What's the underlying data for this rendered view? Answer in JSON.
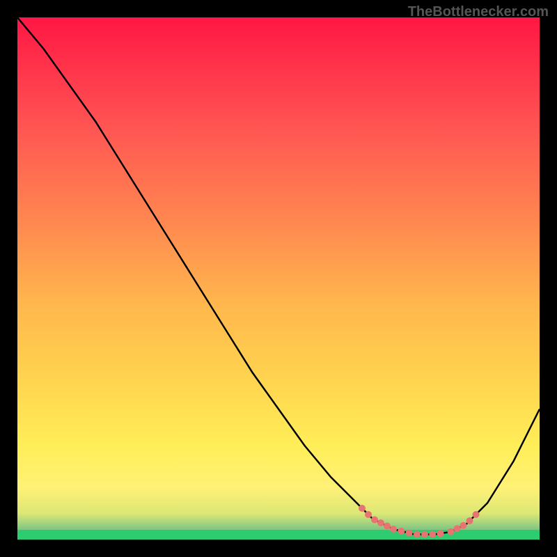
{
  "watermark": "TheBottlenecker.com",
  "chart_data": {
    "type": "line",
    "title": "",
    "xlabel": "",
    "ylabel": "",
    "xlim": [
      0,
      100
    ],
    "ylim": [
      0,
      100
    ],
    "grid": false,
    "series": [
      {
        "name": "curve",
        "x": [
          0,
          5,
          10,
          15,
          20,
          25,
          30,
          35,
          40,
          45,
          50,
          55,
          60,
          65,
          68,
          72,
          76,
          80,
          83,
          86,
          90,
          95,
          100
        ],
        "y": [
          100,
          94,
          87,
          80,
          72,
          64,
          56,
          48,
          40,
          32,
          25,
          18,
          12,
          7,
          4,
          2,
          1,
          1,
          1.5,
          3,
          7,
          15,
          25
        ]
      }
    ],
    "optimal_zone": {
      "x_start": 66,
      "x_end": 88
    },
    "gradient_stops": [
      {
        "offset": 0,
        "color": "#ff1744"
      },
      {
        "offset": 20,
        "color": "#ff5252"
      },
      {
        "offset": 40,
        "color": "#ff8a50"
      },
      {
        "offset": 55,
        "color": "#ffb74d"
      },
      {
        "offset": 70,
        "color": "#ffd54f"
      },
      {
        "offset": 82,
        "color": "#ffee58"
      },
      {
        "offset": 90,
        "color": "#fff176"
      },
      {
        "offset": 95,
        "color": "#dce775"
      },
      {
        "offset": 98,
        "color": "#81c784"
      },
      {
        "offset": 100,
        "color": "#4caf50"
      }
    ]
  }
}
